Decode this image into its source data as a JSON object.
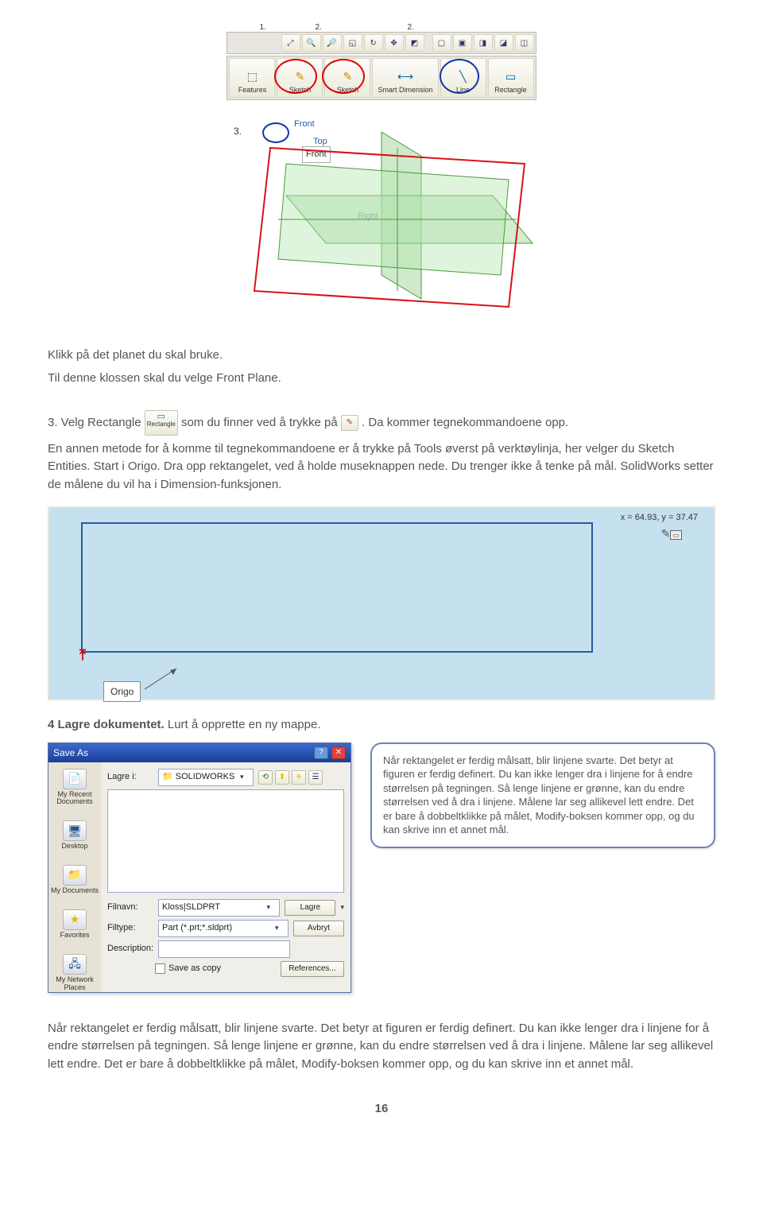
{
  "toolbar": {
    "buttons": [
      "Features",
      "Sketch",
      "Sketch",
      "Smart Dimension",
      "Line",
      "Rectangle"
    ],
    "numbers": [
      "1.",
      "2.",
      "2."
    ]
  },
  "planes": {
    "step3": "3.",
    "front": "Front",
    "top": "Top",
    "right": "Right",
    "front_boxed": "Front"
  },
  "intro": {
    "p1": "Klikk på det planet du skal bruke.",
    "p2": "Til denne klossen skal du velge Front Plane.",
    "p3a": "3. Velg Rectangle ",
    "p3b": " som du finner ved å trykke på ",
    "p3c": ". Da kommer tegnekommandoene opp.",
    "icon_rect": "Rectangle",
    "p4": "En annen metode for å komme til tegnekommandoene er å trykke på Tools øverst på verktøylinja, her velger du Sketch Entities. Start i Origo. Dra opp rektangelet, ved å holde museknappen nede. Du trenger ikke å tenke på mål. SolidWorks setter de målene du vil ha i Dimension-funksjonen."
  },
  "drawing": {
    "coords": "x = 64.93, y = 37.47",
    "origo": "Origo"
  },
  "section4": {
    "heading_a": "4 Lagre dokumentet.",
    "heading_b": " Lurt å opprette en ny mappe."
  },
  "saveas": {
    "title": "Save As",
    "lagre_i": "Lagre i:",
    "folder": "SOLIDWORKS",
    "sidebar": [
      "My Recent Documents",
      "Desktop",
      "My Documents",
      "Favorites",
      "My Network Places"
    ],
    "filnavn": "Filnavn:",
    "filnavn_val": "Kloss|SLDPRT",
    "filtype": "Filtype:",
    "filtype_val": "Part (*.prt;*.sldprt)",
    "description": "Description:",
    "save_as_copy": "Save as copy",
    "lagre_btn": "Lagre",
    "avbryt_btn": "Avbryt",
    "references": "References..."
  },
  "note": "Når rektangelet er ferdig målsatt, blir linjene svarte. Det betyr at figuren er ferdig definert. Du kan ikke lenger dra i linjene for å endre størrelsen på tegningen. Så lenge linjene er grønne, kan du endre størrelsen ved å dra i linjene. Målene lar seg allikevel lett endre. Det er bare å dobbeltklikke på målet, Modify-boksen kommer opp, og du kan skrive inn et annet mål.",
  "footer": "Når rektangelet er ferdig målsatt, blir linjene svarte. Det betyr at figuren er ferdig definert. Du kan ikke lenger dra i linjene for å endre størrelsen på tegningen. Så lenge linjene er grønne, kan du endre størrelsen ved å dra i linjene. Målene lar seg allikevel lett endre. Det er bare å dobbeltklikke på målet, Modify-boksen kommer opp, og du kan skrive inn et annet mål.",
  "page": "16"
}
